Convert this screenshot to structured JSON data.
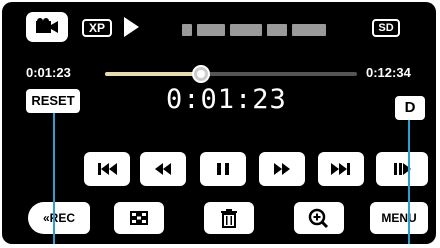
{
  "header": {
    "mode_icon": "video-camera-icon",
    "quality": "XP",
    "status_icon": "play-icon",
    "media": "SD"
  },
  "timeline": {
    "elapsed": "0:01:23",
    "total": "0:12:34",
    "progress": 0.38
  },
  "counter": {
    "reset_label": "RESET",
    "display": "0:01:23",
    "d_label": "D"
  },
  "controls": {
    "buttons": [
      "skip-back-icon",
      "rewind-icon",
      "pause-icon",
      "fast-forward-icon",
      "skip-forward-icon",
      "frame-advance-icon"
    ]
  },
  "bottom_bar": {
    "rec_label": "REC",
    "index_icon": "index-grid-icon",
    "delete_icon": "trash-icon",
    "zoom_icon": "zoom-in-icon",
    "menu_label": "MENU"
  },
  "colors": {
    "screen_bg": "#000000",
    "button_bg": "#ffffff",
    "track_fill": "#e8e0a8",
    "leader_line": "#2aa0d0"
  }
}
